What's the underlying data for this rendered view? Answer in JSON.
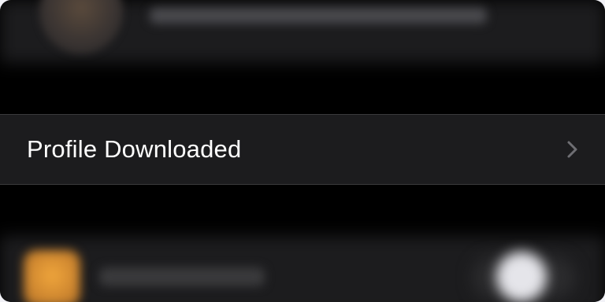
{
  "profile_row": {
    "label": "Profile Downloaded",
    "chevron_icon": "chevron-right-icon"
  },
  "colors": {
    "background": "#000000",
    "row_background": "#1c1c1e",
    "separator": "#3a3a3c",
    "label_text": "#ffffff",
    "chevron": "#6e6e73",
    "blurred_app_icon": "#e89a36"
  }
}
